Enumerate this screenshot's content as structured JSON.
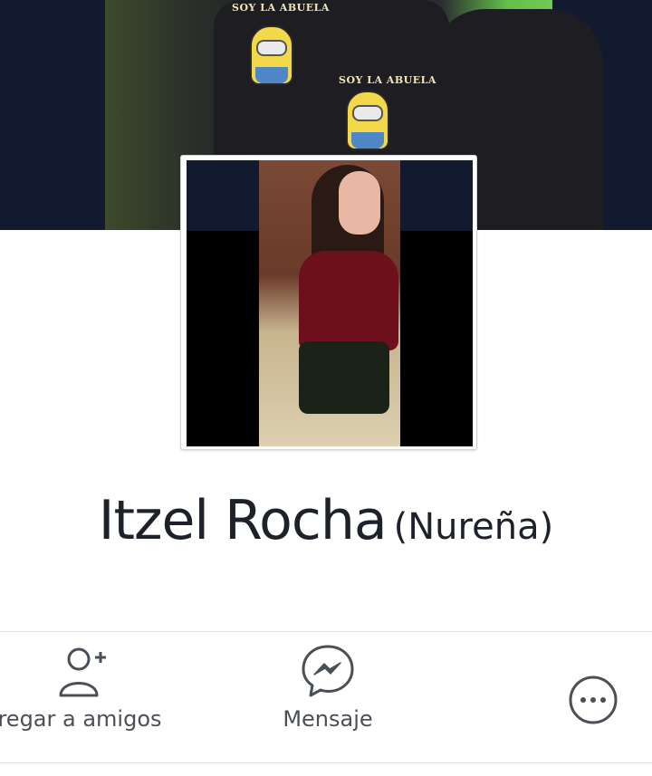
{
  "profile": {
    "name": "Itzel Rocha",
    "alternate_name": "(Nureña)",
    "cover_shirt_text_1": "SOY LA ABUELA",
    "cover_shirt_text_2": "SOY LA ABUELA"
  },
  "actions": {
    "add_friend_label": "regar a amigos",
    "message_label": "Mensaje"
  },
  "icons": {
    "add_friend": "add-friend-icon",
    "message": "messenger-icon",
    "more": "more-options-icon"
  },
  "colors": {
    "cover_bg": "#121a30",
    "text_primary": "#1d2129",
    "icon_gray": "#4b4f56",
    "divider": "#dddfe2"
  }
}
